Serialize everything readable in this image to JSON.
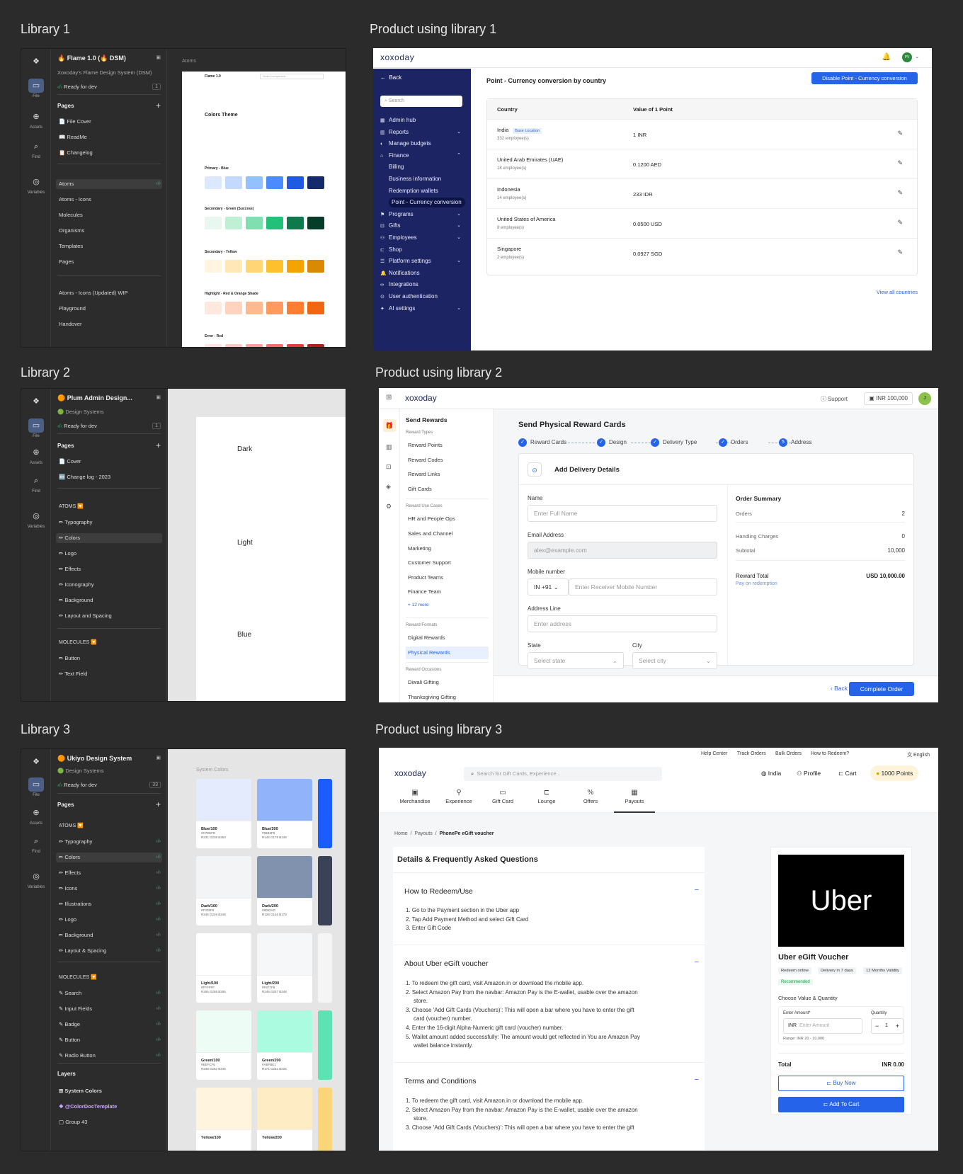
{
  "sections": {
    "lib1": "Library 1",
    "prod1": "Product using library 1",
    "lib2": "Library 2",
    "prod2": "Product using library 2",
    "lib3": "Library 3",
    "prod3": "Product using library 3"
  },
  "rail": {
    "file": "File",
    "assets": "Assets",
    "find": "Find",
    "variables": "Variables"
  },
  "lib1": {
    "title": "🔥 Flame 1.0 (🔥 DSM)",
    "subtitle": "Xoxoday's Flame Design System (DSM)",
    "ready": "Ready for dev",
    "ready_count": "1",
    "pages_label": "Pages",
    "pages": [
      "📄 File Cover",
      "📖 ReadMe",
      "📋 Changelog",
      "Atoms",
      "Atoms - Icons",
      "Molecules",
      "Organisms",
      "Templates",
      "Pages",
      "Atoms - Icons (Updated) WIP",
      "Playground",
      "Handover"
    ],
    "canvas_label": "Atoms",
    "doc_title": "Flame 1.0",
    "doc_search": "Select component...",
    "doc_heading": "Colors Theme",
    "doc_groups": [
      "Primary - Blue",
      "Secondary - Green (Success)",
      "Secondary - Yellow",
      "Highlight - Red & Orange Shade",
      "Error - Red"
    ]
  },
  "prod1": {
    "logo": "xoxoday",
    "avatar": "PV",
    "back": "Back",
    "search": "Search",
    "page_title": "Point - Currency conversion by country",
    "disable_btn": "Disable Point - Currency conversion",
    "nav": [
      {
        "label": "Admin hub",
        "chev": ""
      },
      {
        "label": "Reports",
        "chev": "⌄"
      },
      {
        "label": "Manage budgets",
        "chev": ""
      },
      {
        "label": "Finance",
        "chev": "⌃"
      },
      {
        "label": "Billing",
        "chev": "",
        "sub": true
      },
      {
        "label": "Business information",
        "chev": "",
        "sub": true
      },
      {
        "label": "Redemption wallets",
        "chev": "",
        "sub": true
      },
      {
        "label": "Point - Currency conversion",
        "chev": "",
        "sub": true,
        "active": true
      },
      {
        "label": "Programs",
        "chev": "⌄"
      },
      {
        "label": "Gifts",
        "chev": "⌄"
      },
      {
        "label": "Employees",
        "chev": "⌄"
      },
      {
        "label": "Shop",
        "chev": ""
      },
      {
        "label": "Platform settings",
        "chev": "⌄"
      },
      {
        "label": "Notifications",
        "chev": ""
      },
      {
        "label": "Integrations",
        "chev": ""
      },
      {
        "label": "User authentication",
        "chev": ""
      },
      {
        "label": "AI settings",
        "chev": "⌄"
      }
    ],
    "col_country": "Country",
    "col_value": "Value of 1 Point",
    "base_tag": "Base Location",
    "rows": [
      {
        "country": "India",
        "emp": "332 employee(s)",
        "value": "1 INR"
      },
      {
        "country": "United Arab Emirates (UAE)",
        "emp": "18 employee(s)",
        "value": "0.1200 AED"
      },
      {
        "country": "Indonesia",
        "emp": "14 employee(s)",
        "value": "233 IDR"
      },
      {
        "country": "United States of America",
        "emp": "8 employee(s)",
        "value": "0.0500 USD"
      },
      {
        "country": "Singapore",
        "emp": "2 employee(s)",
        "value": "0.0927 SGD"
      }
    ],
    "view_all": "View all countries"
  },
  "lib2": {
    "title": "🟠 Plum Admin Design...",
    "subtitle": "🟢 Design Systems",
    "ready": "Ready for dev",
    "ready_count": "1",
    "pages_label": "Pages",
    "pages": [
      "📄 Cover",
      "🔤 Change log - 2023"
    ],
    "atoms_label": "ATOMS 🔽",
    "atoms": [
      "Typography",
      "Colors",
      "Logo",
      "Effects",
      "Iconography",
      "Background",
      "Layout and Spacing"
    ],
    "mol_label": "MOLECULES 🔽",
    "molecules": [
      "Button",
      "Text Field"
    ],
    "canvas": [
      "Dark",
      "Light",
      "Blue"
    ]
  },
  "prod2": {
    "logo": "xoxoday",
    "support": "Support",
    "balance": "INR 100,000",
    "avatar": "J",
    "send": "Send Rewards",
    "groups": [
      {
        "label": "Reward Types",
        "items": [
          "Reward Points",
          "Reward Codes",
          "Reward Links",
          "Gift Cards"
        ]
      },
      {
        "label": "Reward Use Cases",
        "items": [
          "HR and People Ops",
          "Sales and Channel",
          "Marketing",
          "Customer Support",
          "Product Teams",
          "Finance Team"
        ],
        "more": "+ 12 more"
      },
      {
        "label": "Reward Formats",
        "items": [
          "Digital Rewards",
          "Physical Rewards"
        ]
      },
      {
        "label": "Reward Occasions",
        "items": [
          "Diwali Gifting",
          "Thanksgiving Gifting"
        ]
      }
    ],
    "heading": "Send Physical Reward Cards",
    "steps": [
      "Reward Cards",
      "Design",
      "Delivery Type",
      "Orders",
      "Address"
    ],
    "step5": "5",
    "card_title": "Add Delivery Details",
    "name_label": "Name",
    "name_ph": "Enter Full Name",
    "email_label": "Email Address",
    "email_val": "alex@example.com",
    "mobile_label": "Mobile number",
    "code": "IN +91",
    "mobile_ph": "Enter Receiver Mobile Number",
    "addr_label": "Address Line",
    "addr_ph": "Enter address",
    "state_label": "State",
    "state_ph": "Select state",
    "city_label": "City",
    "city_ph": "Select city",
    "summary": {
      "title": "Order Summary",
      "orders_l": "Orders",
      "orders_v": "2",
      "handling_l": "Handling Charges",
      "handling_v": "0",
      "subtotal_l": "Subtotal",
      "subtotal_v": "10,000",
      "total_l": "Reward Total",
      "total_v": "USD 10,000.00",
      "pay": "Pay on redemption"
    },
    "back": "Back",
    "complete": "Complete Order"
  },
  "lib3": {
    "title": "🟠 Ukiyo Design System",
    "subtitle": "🟢 Design Systems",
    "ready": "Ready for dev",
    "ready_count": "33",
    "pages_label": "Pages",
    "atoms_label": "ATOMS 🔽",
    "atoms": [
      "Typography",
      "Colors",
      "Effects",
      "Icons",
      "Illustrations",
      "Logo",
      "Background",
      "Layout & Spacing"
    ],
    "mol_label": "MOLECULES 🔽",
    "molecules": [
      "Search",
      "Input Fields",
      "Badge",
      "Button",
      "Radio Button"
    ],
    "layers_label": "Layers",
    "layers": [
      "System Colors",
      "@ColorDocTemplate",
      "Group 43"
    ],
    "canvas_label": "System Colors",
    "swatches": [
      [
        {
          "n": "Blue/100",
          "v1": "#C7EEFD",
          "v2": "R231 G238 B253",
          "c": "#e3ebfd"
        },
        {
          "n": "Blue/200",
          "v1": "#96B3F9",
          "v2": "R144 G179 B249",
          "c": "#90b3f9"
        }
      ],
      [
        {
          "n": "Dark/100",
          "v1": "#F3F6F8",
          "v2": "R245 G246 B248",
          "c": "#f3f4f6"
        },
        {
          "n": "Dark/200",
          "v1": "#8092AD",
          "v2": "R128 G146 B173",
          "c": "#8092ad"
        }
      ],
      [
        {
          "n": "Light/100",
          "v1": "#FFFFFF",
          "v2": "R255 G255 B255",
          "c": "#ffffff"
        },
        {
          "n": "Light/200",
          "v1": "#F6F7F8",
          "v2": "R246 G247 B248",
          "c": "#f6f7f8"
        }
      ],
      [
        {
          "n": "Green/100",
          "v1": "#EEFCF6",
          "v2": "R238 G252 B246",
          "c": "#eefcf6"
        },
        {
          "n": "Green/200",
          "v1": "#ABFBE1",
          "v2": "R171 G251 B225",
          "c": "#abfbe1"
        }
      ],
      [
        {
          "n": "Yellow/100",
          "v1": "",
          "v2": "",
          "c": "#fff5de"
        },
        {
          "n": "Yellow/200",
          "v1": "",
          "v2": "",
          "c": "#fdecc4"
        }
      ]
    ]
  },
  "prod3": {
    "top_links": [
      "Help Center",
      "Track Orders",
      "Bulk Orders",
      "How to Redeem?"
    ],
    "lang": "English",
    "logo": "xoxoday",
    "search_ph": "Search for Gift Cards, Experience...",
    "country": "India",
    "profile": "Profile",
    "cart": "Cart",
    "points": "1000 Points",
    "tabs": [
      "Merchandise",
      "Experience",
      "Gift Card",
      "Lounge",
      "Offers",
      "Payouts"
    ],
    "crumbs": [
      "Home",
      "Payouts",
      "PhonePe eGift voucher"
    ],
    "title": "Details & Frequently Asked Questions",
    "redeem_h": "How to Redeem/Use",
    "redeem": [
      "1. Go to the Payment section in the Uber app",
      "2. Tap Add Payment Method and select Gift Card",
      "3. Enter Gift Code"
    ],
    "about_h": "About Uber eGift voucher",
    "about": [
      "1. To redeem the gift card, visit Amazon.in or download the mobile app.",
      "2. Select Amazon Pay from the navbar: Amazon Pay is the E-wallet, usable over the amazon",
      "store.",
      "3. Choose 'Add Gift Cards (Vouchers)': This will open a bar where you have to enter the gift",
      "card (voucher) number.",
      "4. Enter the 16-digit Alpha-Numeric gift card (voucher) number.",
      "5. Wallet amount added successfully: The amount would get reflected in You are Amazon Pay",
      "wallet balance instantly."
    ],
    "terms_h": "Terms and Conditions",
    "terms": [
      "1. To redeem the gift card, visit Amazon.in or download the mobile app.",
      "2. Select Amazon Pay from the navbar: Amazon Pay is the E-wallet, usable over the amazon",
      "store.",
      "3. Choose 'Add Gift Cards (Vouchers)': This will open a bar where you have to enter the gift"
    ],
    "brand": "Uber",
    "voucher": "Uber eGift Voucher",
    "chips": [
      "Redeem online",
      "Delivery in 7 days",
      "12 Months Validity"
    ],
    "recommended": "Recommended",
    "choose": "Choose Value & Quantity",
    "amount_l": "Enter Amount*",
    "currency": "INR",
    "amount_ph": "Enter Amount",
    "qty_l": "Quantity",
    "qty": "1",
    "range": "Range: INR 20 - 10,000",
    "total_l": "Total",
    "total_v": "INR 0.00",
    "buy": "Buy Now",
    "add": "Add To Cart"
  }
}
